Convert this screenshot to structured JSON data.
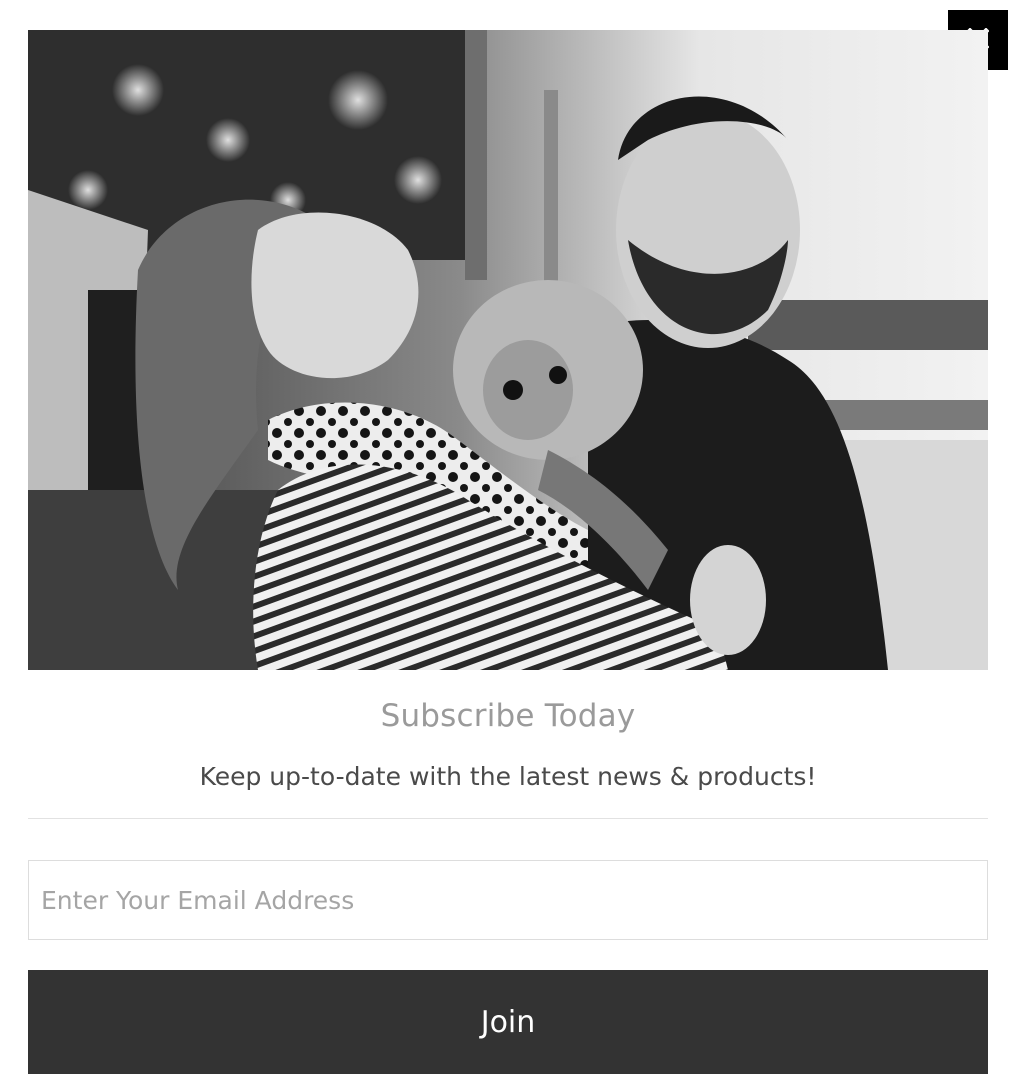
{
  "modal": {
    "close_icon": "close-icon",
    "photo_icon": "hero-photo"
  },
  "content": {
    "title": "Subscribe Today",
    "subtitle": "Keep up-to-date with the latest news & products!"
  },
  "form": {
    "email_value": "",
    "email_placeholder": "Enter Your Email Address",
    "join_label": "Join"
  },
  "colors": {
    "button_background": "#333333",
    "close_background": "#000000",
    "title_color": "#9a9a9a"
  }
}
